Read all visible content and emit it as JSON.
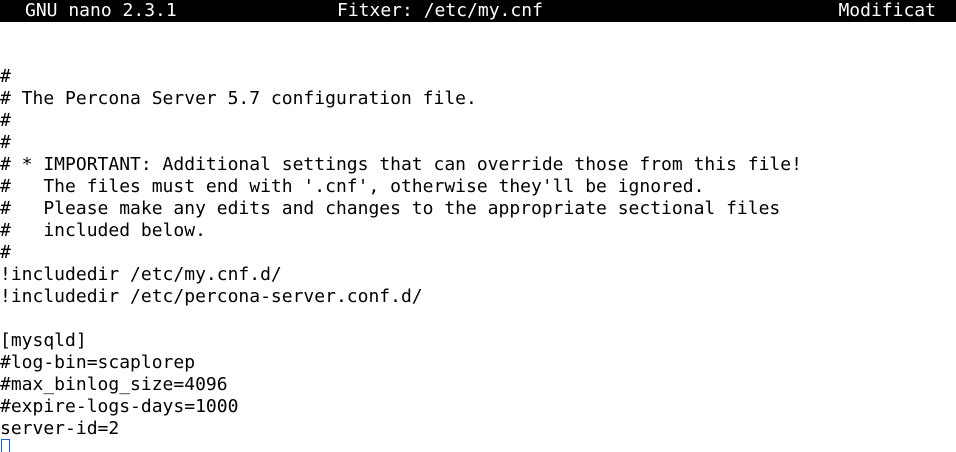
{
  "titlebar": {
    "app": "GNU nano 2.3.1",
    "file": "Fitxer: /etc/my.cnf",
    "status": "Modificat"
  },
  "buffer": {
    "lines": [
      "#",
      "# The Percona Server 5.7 configuration file.",
      "#",
      "#",
      "# * IMPORTANT: Additional settings that can override those from this file!",
      "#   The files must end with '.cnf', otherwise they'll be ignored.",
      "#   Please make any edits and changes to the appropriate sectional files",
      "#   included below.",
      "#",
      "!includedir /etc/my.cnf.d/",
      "!includedir /etc/percona-server.conf.d/",
      "",
      "[mysqld]",
      "#log-bin=scaplorep",
      "#max_binlog_size=4096",
      "#expire-logs-days=1000",
      "server-id=2"
    ]
  }
}
